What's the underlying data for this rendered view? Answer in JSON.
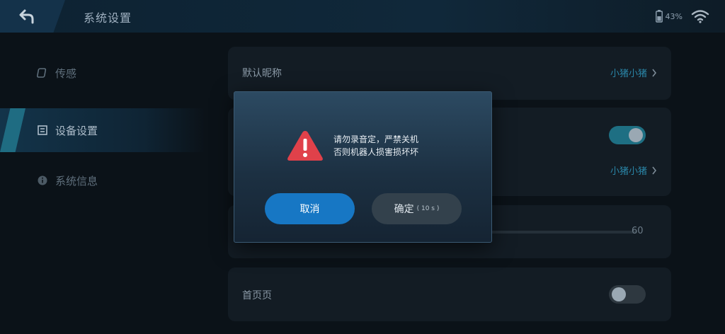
{
  "header": {
    "title": "系统设置",
    "battery_text": "43%"
  },
  "sidebar": {
    "items": [
      {
        "label": "传感",
        "icon": "sensor-icon"
      },
      {
        "label": "设备设置",
        "icon": "device-settings-icon",
        "active": true
      },
      {
        "label": "系统信息",
        "icon": "info-icon"
      }
    ]
  },
  "settings": {
    "default_name": {
      "label": "默认昵称",
      "link": "小猪小猪"
    },
    "toggle_row": {
      "enabled": true,
      "link": "小猪小猪"
    },
    "volume": {
      "value": "60",
      "fraction": 0.6
    },
    "last_row": {
      "label": "首页页",
      "enabled": false
    }
  },
  "dialog": {
    "message_line1": "请勿录音定，严禁关机",
    "message_line2": "否则机器人损害损坏坏",
    "cancel_label": "取消",
    "confirm_label": "确定",
    "confirm_countdown": "( 10 s )"
  },
  "colors": {
    "accent": "#1777c4",
    "warning": "#e0414a",
    "toggle_on": "#1e6f83"
  }
}
